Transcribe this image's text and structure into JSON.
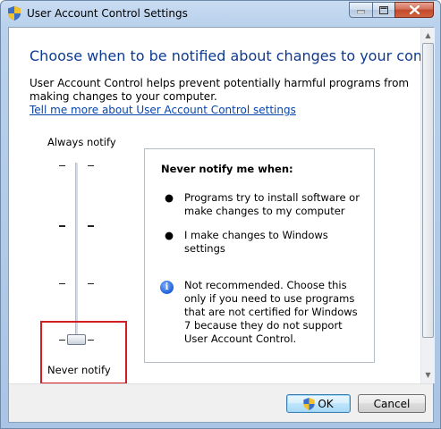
{
  "window": {
    "title": "User Account Control Settings"
  },
  "content": {
    "heading": "Choose when to be notified about changes to your computer",
    "description": "User Account Control helps prevent potentially harmful programs from making changes to your computer.",
    "link": "Tell me more about User Account Control settings"
  },
  "slider": {
    "top_label": "Always notify",
    "bottom_label": "Never notify",
    "levels": 4,
    "selected_level": 1
  },
  "panel": {
    "title": "Never notify me when:",
    "bullets": [
      "Programs try to install software or make changes to my computer",
      "I make changes to Windows settings"
    ],
    "note": "Not recommended. Choose this only if you need to use programs that are not certified for Windows 7 because they do not support User Account Control."
  },
  "buttons": {
    "ok": "OK",
    "cancel": "Cancel"
  },
  "colors": {
    "heading": "#0d3a91",
    "link": "#0645ad",
    "highlight": "#d01f24"
  }
}
